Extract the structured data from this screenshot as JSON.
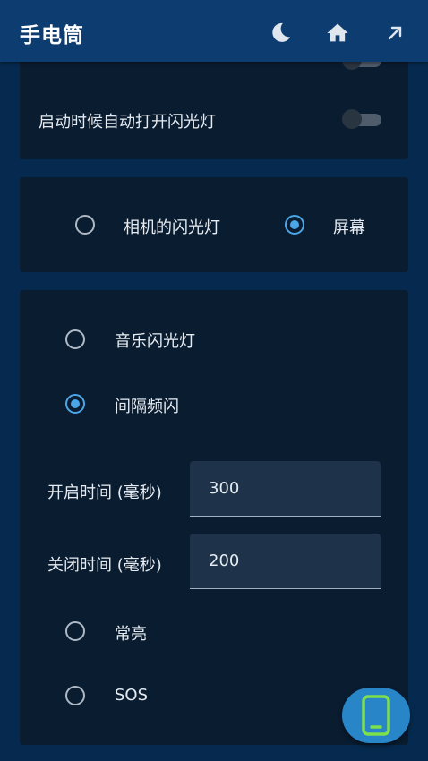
{
  "app": {
    "title": "手电筒"
  },
  "colors": {
    "appbar": "#0d3c70",
    "background": "#062a4f",
    "card": "#0a1c30",
    "accent": "#4ba6e8",
    "fab": "#2785c8",
    "fab_icon": "#7ee04a"
  },
  "toolbar": {
    "icons": [
      "moon-icon",
      "home-icon",
      "arrow-up-right-icon"
    ]
  },
  "settings": {
    "auto_flash_label": "启动时候自动打开闪光灯",
    "auto_flash_on": false,
    "partial_switch_on": false
  },
  "source": {
    "camera_flash_label": "相机的闪光灯",
    "camera_flash_checked": false,
    "screen_label": "屏幕",
    "screen_checked": true
  },
  "modes": {
    "music_label": "音乐闪光灯",
    "music_checked": false,
    "interval_label": "间隔频闪",
    "interval_checked": true,
    "on_time_label": "开启时间 (毫秒)",
    "on_time_value": "300",
    "off_time_label": "关闭时间 (毫秒)",
    "off_time_value": "200",
    "steady_label": "常亮",
    "steady_checked": false,
    "sos_label": "SOS",
    "sos_checked": false
  },
  "fab": {
    "icon": "phone-icon"
  }
}
